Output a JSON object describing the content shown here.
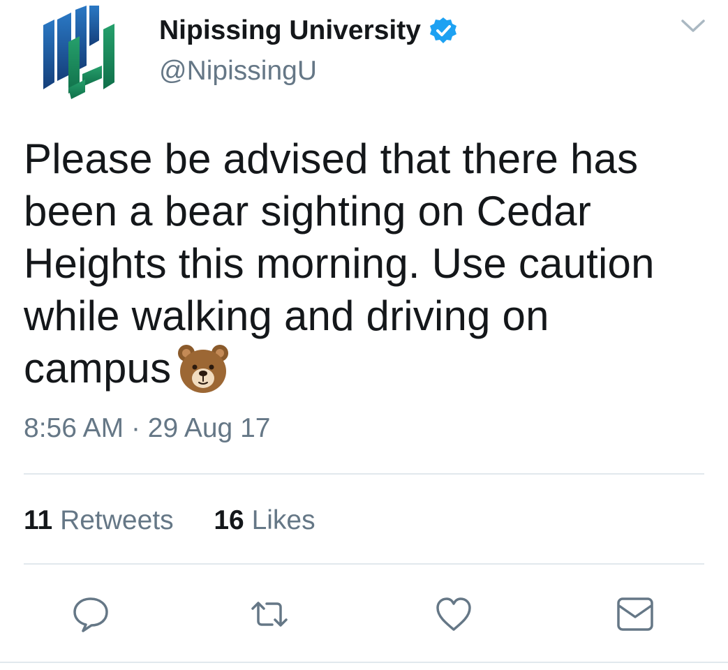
{
  "author": {
    "name": "Nipissing University",
    "handle": "@NipissingU",
    "verified": true,
    "avatar_icon": "nipissing-logo-icon"
  },
  "tweet": {
    "text": "Please be advised that there has been a bear sighting on Cedar Heights this morning. Use caution while walking and driving on campus",
    "emoji": "bear-face-emoji",
    "time": "8:56 AM",
    "separator": "·",
    "date": "29 Aug 17"
  },
  "stats": {
    "retweets_count": "11",
    "retweets_label": "Retweets",
    "likes_count": "16",
    "likes_label": "Likes"
  },
  "actions": [
    {
      "name": "reply",
      "icon": "speech-bubble-icon"
    },
    {
      "name": "retweet",
      "icon": "retweet-arrows-icon"
    },
    {
      "name": "like",
      "icon": "heart-icon"
    },
    {
      "name": "direct-message",
      "icon": "envelope-icon"
    }
  ],
  "colors": {
    "text_primary": "#14171a",
    "text_secondary": "#657786",
    "verified_blue": "#1da1f2",
    "divider": "#e1e8ed",
    "logo_blue": "#1f5fa8",
    "logo_green": "#1a8a5c"
  }
}
